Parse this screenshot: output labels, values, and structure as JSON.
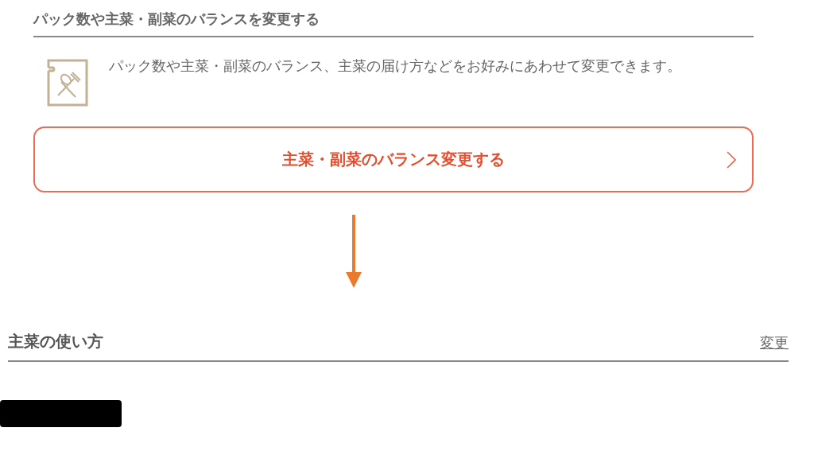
{
  "section": {
    "title": "パック数や主菜・副菜のバランスを変更する",
    "description": "パック数や主菜・副菜のバランス、主菜の届け方などをお好みにあわせて変更できます。",
    "button": "主菜・副菜のバランス変更する"
  },
  "next_section": {
    "title": "主菜の使い方",
    "link": "変更"
  }
}
